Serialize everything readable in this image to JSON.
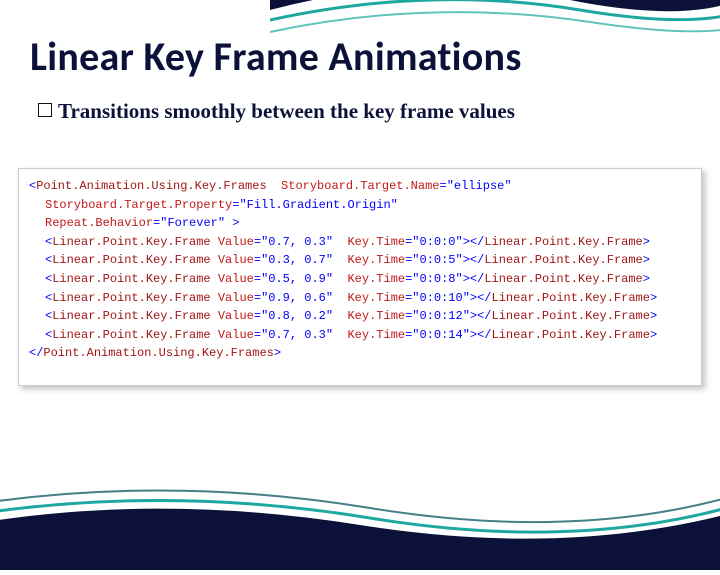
{
  "title": "Linear Key Frame Animations",
  "bullet": "Transitions smoothly between the key frame values",
  "code": {
    "rootOpenA": "<Point.Animation.Using.Key.Frames",
    "rootAttr1Name": "Storyboard.Target.Name",
    "rootAttr1Val": "ellipse",
    "rootAttr2Name": "Storyboard.Target.Property",
    "rootAttr2Val": "Fill.Gradient.Origin",
    "rootAttr3Name": "Repeat.Behavior",
    "rootAttr3Val": "Forever",
    "kfTag": "Linear.Point.Key.Frame",
    "kfAttrVal": "Value",
    "kfAttrKey": "Key.Time",
    "keyframes": [
      {
        "value": "0.7, 0.3",
        "keyTime": "0:0:0"
      },
      {
        "value": "0.3, 0.7",
        "keyTime": "0:0:5"
      },
      {
        "value": "0.5, 0.9",
        "keyTime": "0:0:8"
      },
      {
        "value": "0.9, 0.6",
        "keyTime": "0:0:10"
      },
      {
        "value": "0.8, 0.2",
        "keyTime": "0:0:12"
      },
      {
        "value": "0.7, 0.3",
        "keyTime": "0:0:14"
      }
    ],
    "rootClose": "</Point.Animation.Using.Key.Frames>"
  }
}
